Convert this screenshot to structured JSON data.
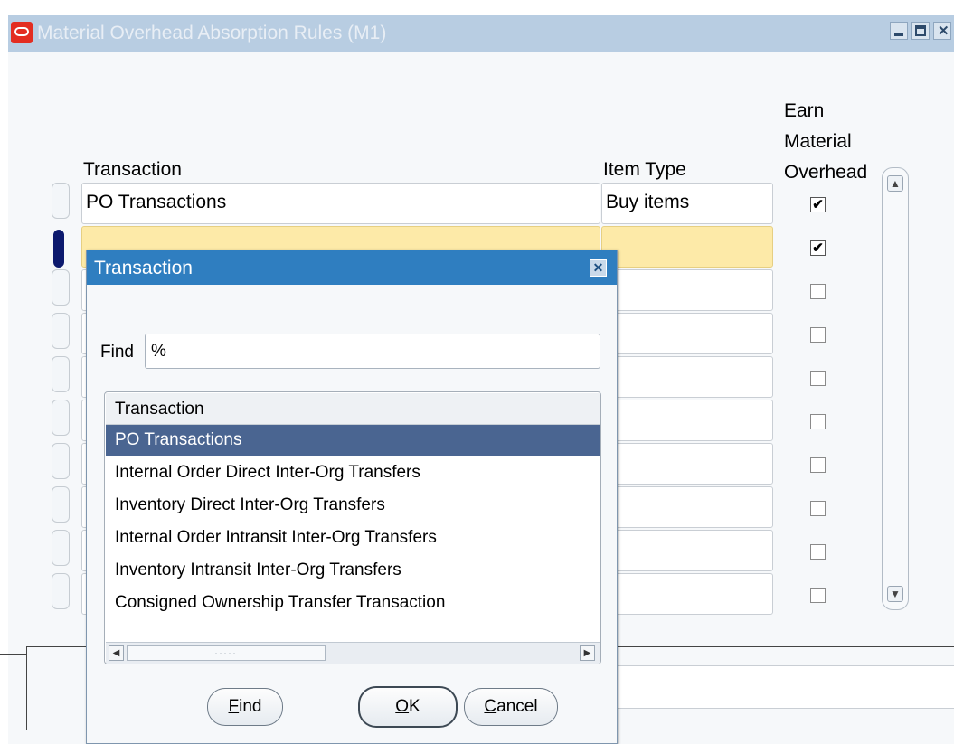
{
  "window": {
    "title": "Material Overhead Absorption Rules (M1)",
    "buttons": [
      "minimize",
      "maximize",
      "close"
    ]
  },
  "columns": {
    "transaction": "Transaction",
    "item_type": "Item Type",
    "earn_line1": "Earn",
    "earn_line2": "Material",
    "earn_line3": "Overhead"
  },
  "rows": [
    {
      "transaction": "PO Transactions",
      "item_type": "Buy items",
      "earn": true
    },
    {
      "transaction": "",
      "item_type": "",
      "earn": true,
      "current": true
    },
    {
      "transaction": "",
      "item_type": "",
      "earn": false
    },
    {
      "transaction": "",
      "item_type": "",
      "earn": false
    },
    {
      "transaction": "",
      "item_type": "",
      "earn": false
    },
    {
      "transaction": "",
      "item_type": "",
      "earn": false
    },
    {
      "transaction": "",
      "item_type": "",
      "earn": false
    },
    {
      "transaction": "",
      "item_type": "",
      "earn": false
    },
    {
      "transaction": "",
      "item_type": "",
      "earn": false
    },
    {
      "transaction": "",
      "item_type": "",
      "earn": false
    }
  ],
  "checkmark": "✔",
  "lov": {
    "title": "Transaction",
    "find_label": "Find",
    "find_value": "%",
    "column_header": "Transaction",
    "items": [
      "PO Transactions",
      "Internal Order Direct Inter-Org Transfers",
      "Inventory Direct Inter-Org Transfers",
      "Internal Order Intransit Inter-Org Transfers",
      "Inventory Intransit Inter-Org Transfers",
      "Consigned Ownership Transfer Transaction"
    ],
    "selected_index": 0,
    "buttons": {
      "find_mnemonic": "F",
      "find_rest": "ind",
      "ok_mnemonic": "O",
      "ok_rest": "K",
      "cancel_mnemonic": "C",
      "cancel_rest": "ancel"
    }
  },
  "colors": {
    "title_bar": "#b8cde2",
    "dialog_title": "#2f7ec0",
    "current_row": "#fdeaa8",
    "selected_item": "#4a6591"
  }
}
